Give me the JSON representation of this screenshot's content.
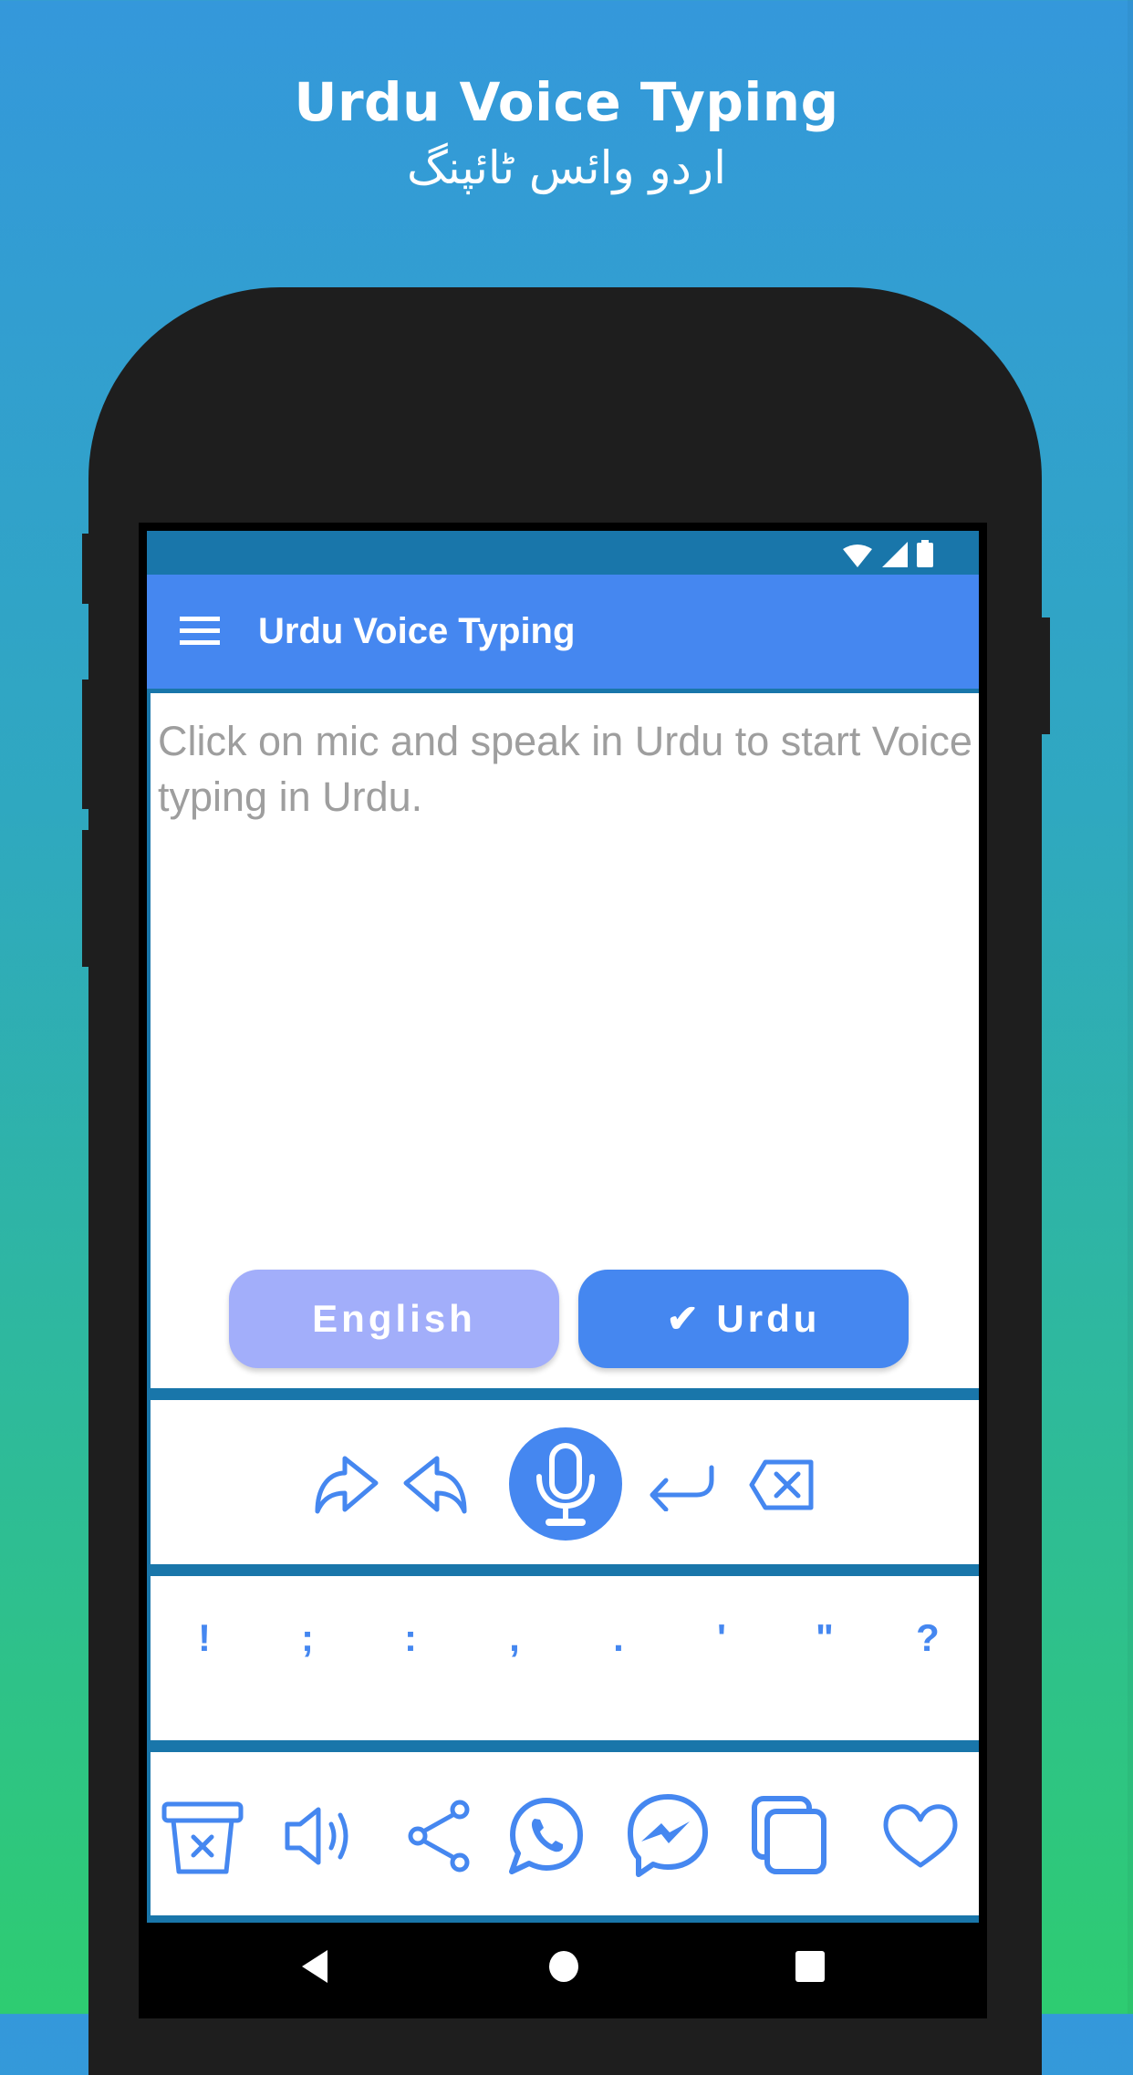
{
  "promo": {
    "title": "Urdu Voice Typing",
    "subtitle": "اردو وائس ٹائپنگ"
  },
  "status_bar": {
    "icons": [
      "wifi-icon",
      "signal-icon",
      "battery-icon"
    ]
  },
  "app_bar": {
    "menu_icon": "hamburger-menu-icon",
    "title": "Urdu Voice Typing"
  },
  "editor": {
    "placeholder": "Click on mic and speak in Urdu to start Voice typing in Urdu.",
    "value": ""
  },
  "language_toggle": {
    "english_label": "English",
    "urdu_label": "✔ Urdu",
    "selected": "Urdu"
  },
  "controls": {
    "items": [
      {
        "name": "redo",
        "icon": "redo-icon"
      },
      {
        "name": "undo",
        "icon": "undo-icon"
      },
      {
        "name": "mic",
        "icon": "microphone-icon"
      },
      {
        "name": "enter",
        "icon": "enter-icon"
      },
      {
        "name": "backspace",
        "icon": "backspace-icon"
      }
    ]
  },
  "punctuation": {
    "keys": [
      "!",
      ";",
      ":",
      ",",
      ".",
      "'",
      "\"",
      "?"
    ]
  },
  "actions": {
    "items": [
      {
        "name": "clear",
        "icon": "clear-trash-icon"
      },
      {
        "name": "speak",
        "icon": "speaker-icon"
      },
      {
        "name": "share",
        "icon": "share-icon"
      },
      {
        "name": "whatsapp",
        "icon": "whatsapp-icon"
      },
      {
        "name": "messenger",
        "icon": "messenger-icon"
      },
      {
        "name": "copy",
        "icon": "copy-icon"
      },
      {
        "name": "favorite",
        "icon": "heart-icon"
      }
    ]
  },
  "nav": {
    "items": [
      "back-icon",
      "home-icon",
      "recents-icon"
    ]
  },
  "colors": {
    "accent": "#4587f0",
    "accent_light": "#a2aefa",
    "primary_dark": "#1976aa",
    "bg_top": "#3498db",
    "bg_bottom": "#2ecc71"
  }
}
